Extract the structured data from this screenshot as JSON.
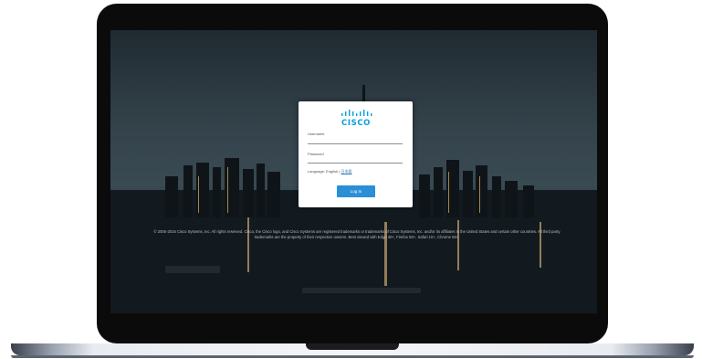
{
  "device": "laptop",
  "brand": {
    "logo_text": "CISCO",
    "accent": "#049fd9"
  },
  "login": {
    "username_label": "Username",
    "username_value": "",
    "password_label": "Password",
    "password_value": "",
    "language_label": "Language:",
    "language_english": "English",
    "language_separator": "|",
    "language_alt": "日本語",
    "login_button": "Log In",
    "button_color": "#2b8fd6"
  },
  "footer": {
    "copyright": "© 2005-2016 Cisco Systems, Inc. All rights reserved. Cisco, the Cisco logo, and Cisco Systems are registered trademarks or trademarks of Cisco Systems, Inc. and/or its affiliates in the United States and certain other countries. All third party trademarks are the property of their respective owners. Best viewed with Edge 40+, Firefox 50+, Safari 10+, Chrome 56+."
  }
}
